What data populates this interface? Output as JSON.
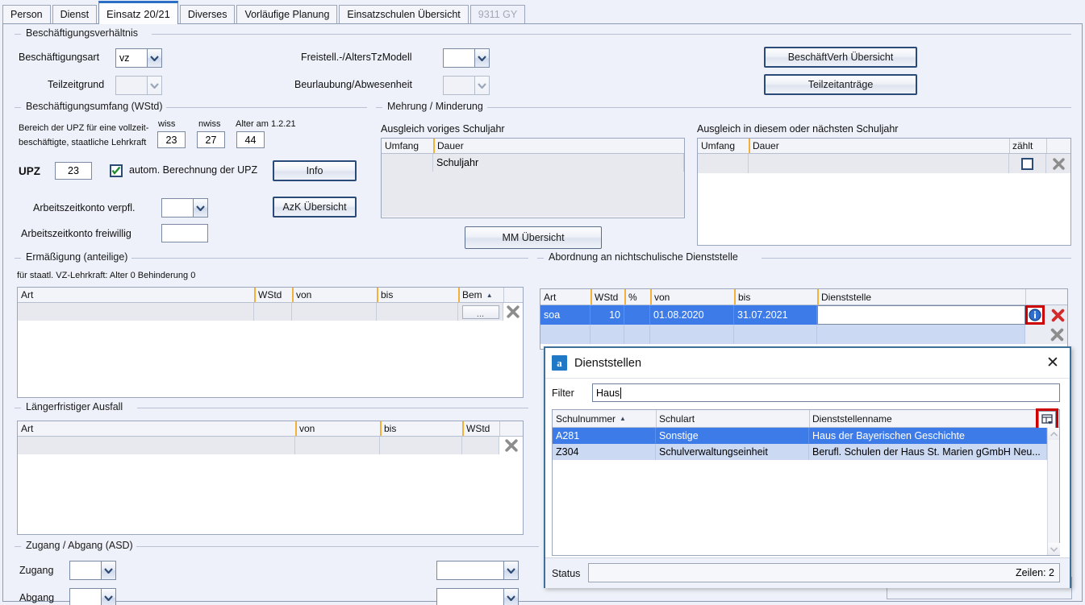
{
  "tabs": [
    {
      "label": "Person",
      "selected": false,
      "disabled": false
    },
    {
      "label": "Dienst",
      "selected": false,
      "disabled": false
    },
    {
      "label": "Einsatz 20/21",
      "selected": true,
      "disabled": false
    },
    {
      "label": "Diverses",
      "selected": false,
      "disabled": false
    },
    {
      "label": "Vorläufige Planung",
      "selected": false,
      "disabled": false
    },
    {
      "label": "Einsatzschulen Übersicht",
      "selected": false,
      "disabled": false
    },
    {
      "label": "9311 GY",
      "selected": false,
      "disabled": true
    }
  ],
  "beschaeftigungsverhaeltnis": {
    "group_title": "Beschäftigungsverhältnis",
    "beschaeftigungsart_label": "Beschäftigungsart",
    "beschaeftigungsart_value": "vz",
    "teilzeitgrund_label": "Teilzeitgrund",
    "teilzeitgrund_value": "",
    "freistell_label": "Freistell.-/AltersTzModell",
    "freistell_value": "",
    "beurlaubung_label": "Beurlaubung/Abwesenheit",
    "beurlaubung_value": "",
    "btn_beschaeftverh": "BeschäftVerh Übersicht",
    "btn_teilzeitantraege": "Teilzeitanträge"
  },
  "beschaeftigungsumfang": {
    "group_title": "Beschäftigungsumfang (WStd)",
    "bereich_line1": "Bereich der UPZ für eine vollzeit-",
    "bereich_line2": "beschäftigte, staatliche Lehrkraft",
    "wiss_label": "wiss",
    "wiss_value": "23",
    "nwiss_label": "nwiss",
    "nwiss_value": "27",
    "alter_label": "Alter am 1.2.21",
    "alter_value": "44",
    "upz_label": "UPZ",
    "upz_value": "23",
    "checkbox_label": "autom. Berechnung der UPZ",
    "checkbox_checked": true,
    "btn_info": "Info",
    "azk_verpfl_label": "Arbeitszeitkonto verpfl.",
    "azk_verpfl_value": "",
    "btn_azk": "AzK Übersicht",
    "azk_freiwillig_label": "Arbeitszeitkonto freiwillig",
    "azk_freiwillig_value": ""
  },
  "mehrung_minderung": {
    "group_title": "Mehrung / Minderung",
    "left_caption": "Ausgleich voriges Schuljahr",
    "left_headers": [
      "Umfang",
      "Dauer"
    ],
    "left_rows": [
      [
        "",
        "Schuljahr"
      ]
    ],
    "right_caption": "Ausgleich in diesem oder nächsten Schuljahr",
    "right_headers": [
      "Umfang",
      "Dauer",
      "zählt",
      ""
    ],
    "right_rows": [
      [
        "",
        "",
        "",
        ""
      ]
    ],
    "btn_mm": "MM Übersicht"
  },
  "ermaessigung": {
    "group_title": "Ermäßigung (anteilige)",
    "subtitle": "für staatl. VZ-Lehrkraft: Alter 0 Behinderung 0",
    "headers": [
      "Art",
      "WStd",
      "von",
      "bis",
      "Bem",
      ""
    ],
    "sort_col": "Bem",
    "rows": [
      [
        "",
        "",
        "",
        "",
        "...",
        ""
      ]
    ]
  },
  "laengerfristiger_ausfall": {
    "group_title": "Längerfristiger Ausfall",
    "headers": [
      "Art",
      "von",
      "bis",
      "WStd",
      ""
    ],
    "rows": [
      [
        "",
        "",
        "",
        "",
        ""
      ]
    ]
  },
  "zugang_abgang": {
    "group_title": "Zugang / Abgang (ASD)",
    "zugang_label": "Zugang",
    "zugang_value": "",
    "zugang_value2": "",
    "abgang_label": "Abgang",
    "abgang_value": "",
    "abgang_value2": ""
  },
  "abordnung": {
    "group_title": "Abordnung an nichtschulische Dienststelle",
    "headers": [
      "Art",
      "WStd",
      "%",
      "von",
      "bis",
      "Dienststelle",
      ""
    ],
    "rows": [
      {
        "art": "soa",
        "wstd": "10",
        "pct": "",
        "von": "01.08.2020",
        "bis": "31.07.2021",
        "dienststelle": "",
        "selected": true
      },
      {
        "art": "",
        "wstd": "",
        "pct": "",
        "von": "",
        "bis": "",
        "dienststelle": "",
        "selected": false
      }
    ]
  },
  "dialog": {
    "icon": "app-icon-a",
    "icon_letter": "a",
    "title": "Dienststellen",
    "close_label": "✕",
    "filter_label": "Filter",
    "filter_value": "Haus",
    "headers": [
      "Schulnummer",
      "Schulart",
      "Dienststellenname"
    ],
    "sort_col": "Schulnummer",
    "rows": [
      {
        "schulnummer": "A281",
        "schulart": "Sonstige",
        "name": "Haus der Bayerischen Geschichte",
        "selected": true
      },
      {
        "schulnummer": "Z304",
        "schulart": "Schulverwaltungseinheit",
        "name": "Berufl. Schulen der Haus St. Marien gGmbH Neu...",
        "selected": false
      }
    ],
    "status_label": "Status",
    "status_value": "",
    "rows_count_label": "Zeilen: 2",
    "column_chooser_icon": "table-columns-icon"
  },
  "icons": {
    "info": "info-icon",
    "delete_red": "delete-red-x-icon",
    "delete_gray": "delete-gray-x-icon",
    "dropdown": "chevron-down-icon",
    "sort_asc": "sort-ascending-icon",
    "checkmark": "checkmark-icon"
  },
  "colors": {
    "accent": "#3d7ce8",
    "selected_row": "#3d7ce8",
    "alt_row": "#ccd9f2",
    "highlight_box": "#cc0000",
    "tab_active": "#2a6fc4",
    "panel_bg": "#eef1f9",
    "header_marker": "#f0b23a"
  }
}
